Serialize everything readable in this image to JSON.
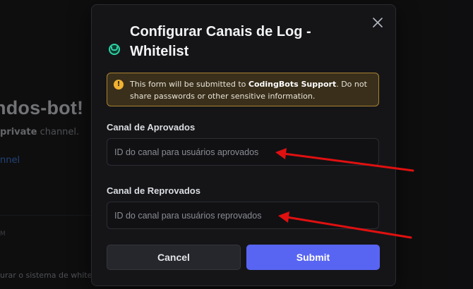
{
  "background": {
    "channel_title": "ndos-bot!",
    "subtitle_bold": "private",
    "subtitle_rest": " channel.",
    "link_text": "nnel",
    "small_text": "M",
    "bottom_text": "urar o sistema de whitelis"
  },
  "modal": {
    "title": "Configurar Canais de Log - Whitelist",
    "warning": {
      "prefix": "This form will be submitted to ",
      "bold": "CodingBots Support",
      "suffix": ". Do not share passwords or other sensitive information.",
      "icon": "!"
    },
    "fields": [
      {
        "label": "Canal de Aprovados",
        "placeholder": "ID do canal para usuários aprovados",
        "value": ""
      },
      {
        "label": "Canal de Reprovados",
        "placeholder": "ID do canal para usuários reprovados",
        "value": ""
      }
    ],
    "cancel_label": "Cancel",
    "submit_label": "Submit"
  },
  "colors": {
    "accent": "#5865f2",
    "warning_border": "#a98332",
    "annotation_arrow": "#e01010"
  },
  "icons": [
    "close-icon",
    "bot-avatar-icon",
    "warning-icon"
  ]
}
